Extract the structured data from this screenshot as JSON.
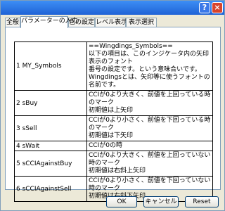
{
  "window": {
    "help_label": "?",
    "close_label": "×"
  },
  "tabs": [
    {
      "label": "全般"
    },
    {
      "label": "パラメーターの入力"
    },
    {
      "label": "色の設定"
    },
    {
      "label": "レベル表示"
    },
    {
      "label": "表示選択"
    }
  ],
  "table": {
    "rows": [
      {
        "name": "1 MY_Symbols",
        "desc": [
          "==Wingdings_Symbols==",
          "以下の項目は、このインジケータ内の矢印表示のフォント",
          "番号の設定です。という意味合いです。",
          "Wingdingsとは、矢印等に使うフォントの名前です。"
        ]
      },
      {
        "name": "2 sBuy",
        "desc": [
          "CCIが0より大きく、前値を上回っている時のマーク",
          "初期値は上矢印"
        ]
      },
      {
        "name": "3 sSell",
        "desc": [
          "CCIが0より小さく、前値を下回っている時のマーク",
          "初期値は下矢印"
        ]
      },
      {
        "name": "4 sWait",
        "desc": [
          "CCIが0の時"
        ]
      },
      {
        "name": "5 sCCIAgainstBuy",
        "desc": [
          "CCIが0より大きく、前値を上回っていない時のマーク",
          "初期値は右斜上矢印"
        ]
      },
      {
        "name": "6 sCCIAgainstSell",
        "desc": [
          "CCIが0より小さく、前値を下回っていない時のマーク",
          "初期値は右斜下矢印"
        ]
      }
    ]
  },
  "buttons": {
    "ok": "OK",
    "cancel": "キャンセル",
    "reset": "Reset"
  }
}
